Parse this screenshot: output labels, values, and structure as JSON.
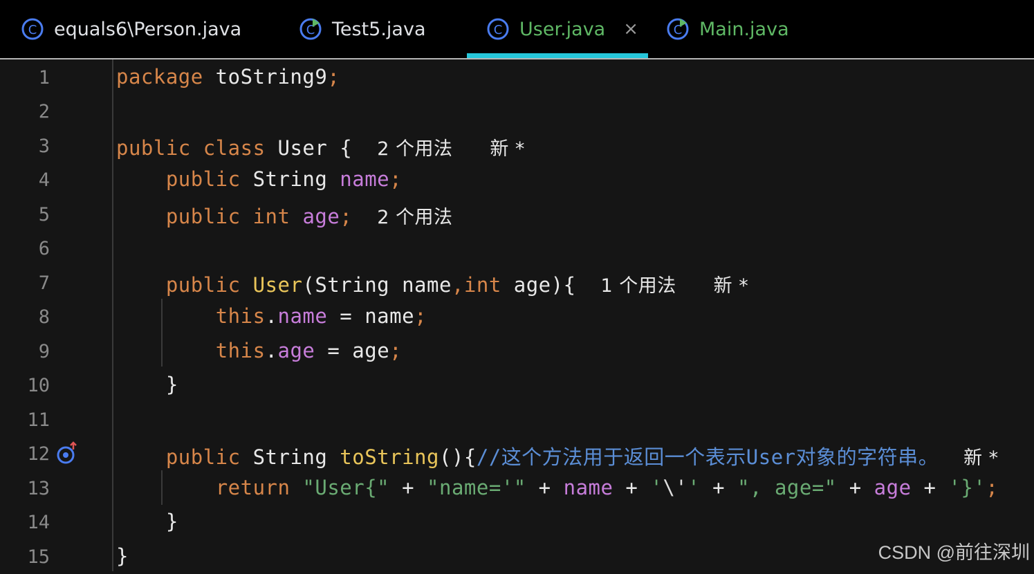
{
  "tabs": [
    {
      "label": "equals6\\Person.java",
      "active": false,
      "color": "#dfe1e5",
      "icon": "class-icon"
    },
    {
      "label": "Test5.java",
      "active": false,
      "color": "#dfe1e5",
      "icon": "test-class-icon"
    },
    {
      "label": "User.java",
      "active": true,
      "color": "#5fb865",
      "icon": "class-icon",
      "close": "×"
    },
    {
      "label": "Main.java",
      "active": false,
      "color": "#5fb865",
      "icon": "run-class-icon"
    }
  ],
  "colors": {
    "keyword": "#d7864a",
    "field": "#c77dda",
    "function": "#e9c55a",
    "string": "#6aab73",
    "comment": "#5b8ed6",
    "active_tab_underline": "#26c6da"
  },
  "editor": {
    "line_numbers": [
      "1",
      "2",
      "3",
      "4",
      "5",
      "6",
      "7",
      "8",
      "9",
      "10",
      "11",
      "12",
      "13",
      "14",
      "15"
    ],
    "lines": {
      "l1": {
        "kw": "package",
        "rest": " toString9",
        "semi": ";"
      },
      "l3": {
        "kw1": "public",
        "kw2": "class",
        "name": " User {",
        "hint_usages": "2 个用法",
        "hint_new": "新 *"
      },
      "l4": {
        "kw": "public",
        "type": " String ",
        "field": "name",
        "semi": ";"
      },
      "l5": {
        "kw1": "public",
        "kw2": "int",
        "field": "age",
        "semi": ";",
        "hint_usages": "2 个用法"
      },
      "l7": {
        "kw": "public",
        "fn": "User",
        "params_a": "(String name",
        "comma": ",",
        "kw2": "int",
        "params_b": " age){",
        "hint_usages": "1 个用法",
        "hint_new": "新 *"
      },
      "l8": {
        "kw": "this",
        "dot": ".",
        "field": "name",
        "rest": " = name",
        "semi": ";"
      },
      "l9": {
        "kw": "this",
        "dot": ".",
        "field": "age",
        "rest": " = age",
        "semi": ";"
      },
      "l10": {
        "text": "}"
      },
      "l12": {
        "kw": "public",
        "type": " String ",
        "fn": "toString",
        "rest": "(){",
        "comment": "//这个方法用于返回一个表示User对象的字符串。",
        "hint_new": "新 *"
      },
      "l13": {
        "kw": "return",
        "s1": "\"User{\"",
        "plus1": " + ",
        "s2": "\"name='\"",
        "plus2": " + ",
        "f1": "name",
        "plus3": " + ",
        "s3a": "'",
        "s3b": "\\'",
        "s3c": "'",
        "plus4": " + ",
        "s4": "\", age=\"",
        "plus5": " + ",
        "f2": "age",
        "plus6": " + ",
        "s5": "'}'",
        "semi": ";"
      },
      "l14": {
        "text": "}"
      },
      "l15": {
        "text": "}"
      }
    }
  },
  "watermark": "CSDN @前往深圳"
}
